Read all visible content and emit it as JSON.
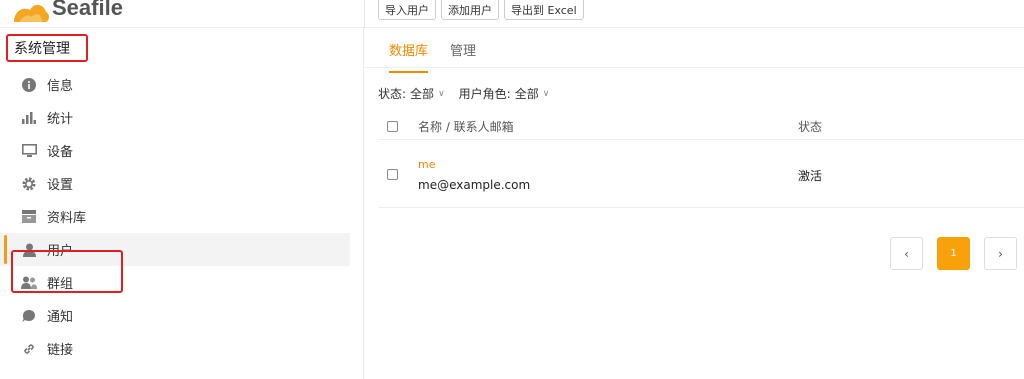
{
  "brand": {
    "name": "Seafile"
  },
  "toolbar": {
    "import_label": "导入用户",
    "add_label": "添加用户",
    "export_label": "导出到 Excel"
  },
  "sidebar": {
    "title": "系统管理",
    "items": [
      {
        "label": "信息",
        "icon": "info-icon"
      },
      {
        "label": "统计",
        "icon": "bar-chart-icon"
      },
      {
        "label": "设备",
        "icon": "monitor-icon"
      },
      {
        "label": "设置",
        "icon": "gear-icon"
      },
      {
        "label": "资料库",
        "icon": "library-icon"
      },
      {
        "label": "用户",
        "icon": "user-icon",
        "active": true
      },
      {
        "label": "群组",
        "icon": "group-icon"
      },
      {
        "label": "通知",
        "icon": "notification-icon"
      },
      {
        "label": "链接",
        "icon": "link-icon"
      }
    ]
  },
  "tabs": [
    {
      "label": "数据库",
      "active": true
    },
    {
      "label": "管理"
    }
  ],
  "filters": {
    "status_label": "状态:",
    "status_value": "全部",
    "role_label": "用户角色:",
    "role_value": "全部"
  },
  "table": {
    "headers": {
      "name": "名称 / 联系人邮箱",
      "status": "状态"
    },
    "rows": [
      {
        "name": "me",
        "email": "me@example.com",
        "status": "激活"
      }
    ]
  },
  "pagination": {
    "current": "1",
    "prev": "‹",
    "next": "›"
  },
  "colors": {
    "accent": "#f08a00",
    "highlight": "#e02020"
  }
}
